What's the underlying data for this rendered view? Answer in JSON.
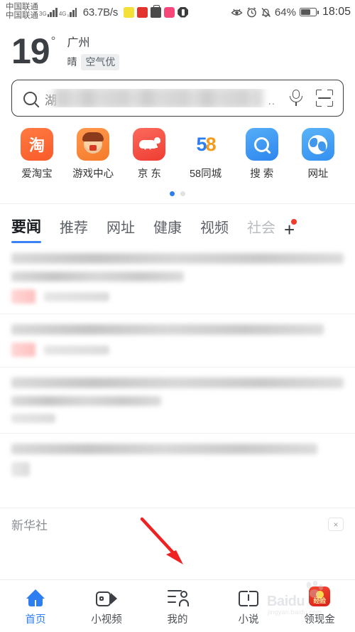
{
  "status_bar": {
    "carrier_line1": "中国联通",
    "carrier_line2": "中国联通",
    "sim1_network": "3G",
    "sim2_network": "4G",
    "network_speed": "63.7B/s",
    "battery_percent": "64%",
    "clock": "18:05",
    "notification_icons": [
      "app-yellow-icon",
      "app-red-icon",
      "briefcase-icon",
      "app-pink-icon",
      "app-octagon-icon"
    ],
    "right_icons": [
      "eye-comfort-icon",
      "alarm-clock-icon",
      "bell-muted-icon",
      "battery-icon"
    ]
  },
  "weather": {
    "temperature": "19",
    "degree_symbol": "°",
    "city": "广州",
    "condition": "晴",
    "air_quality": "空气优"
  },
  "search": {
    "query_prefix": "湖",
    "query_masked": true,
    "trailing_dots": "..",
    "mic_icon": "microphone-icon",
    "scan_icon": "qr-scan-icon",
    "search_icon": "search-icon"
  },
  "shortcuts": {
    "items": [
      {
        "label": "爱淘宝",
        "icon": "taobao-icon",
        "glyph": "淘",
        "color": "#f85a2a"
      },
      {
        "label": "游戏中心",
        "icon": "game-center-icon",
        "color": "#f57a2b"
      },
      {
        "label": "京 东",
        "icon": "jd-icon",
        "color": "#ef3d32"
      },
      {
        "label": "58同城",
        "icon": "58tongcheng-icon",
        "digit_5": "5",
        "digit_8": "8",
        "color_5": "#2d7ef0",
        "color_8": "#f59b1c"
      },
      {
        "label": "搜 索",
        "icon": "search-app-icon",
        "color": "#2d85ef"
      },
      {
        "label": "网址",
        "icon": "website-globe-icon",
        "color": "#3290f0"
      }
    ],
    "page_dots": {
      "count": 2,
      "active_index": 0,
      "active_color": "#2d7ef0"
    }
  },
  "tabs": {
    "items": [
      {
        "label": "要闻",
        "state": "active"
      },
      {
        "label": "推荐",
        "state": "normal"
      },
      {
        "label": "网址",
        "state": "normal"
      },
      {
        "label": "健康",
        "state": "normal"
      },
      {
        "label": "视频",
        "state": "normal"
      },
      {
        "label": "社会",
        "state": "faded"
      }
    ],
    "add_button": "+",
    "add_badge": true,
    "active_underline_color": "#3b82f6"
  },
  "content": {
    "masked": true,
    "articles": [
      {
        "masked_lines": 2,
        "has_thumb_chip": true
      },
      {
        "masked_lines": 1,
        "has_thumb_chip": true
      },
      {
        "masked_lines": 2,
        "has_thumb_chip": false
      },
      {
        "masked_lines": 1,
        "has_thumb_chip": true
      }
    ],
    "source_bar": {
      "source_name": "新华社",
      "close_label": "×"
    }
  },
  "annotation": {
    "type": "red-arrow",
    "color": "#ee2222",
    "points_to": "我的"
  },
  "bottom_nav": {
    "items": [
      {
        "label": "首页",
        "icon": "home-icon",
        "state": "active"
      },
      {
        "label": "小视频",
        "icon": "short-video-icon",
        "state": "normal"
      },
      {
        "label": "我的",
        "icon": "profile-icon",
        "state": "normal"
      },
      {
        "label": "小说",
        "icon": "book-icon",
        "state": "normal"
      },
      {
        "label": "领现金",
        "icon": "cash-reward-icon",
        "state": "normal"
      }
    ],
    "active_color": "#2d7ef0"
  },
  "watermark": {
    "brand": "Baidu",
    "sub": "jingyan.baidu.com",
    "badge_text": "经验"
  }
}
